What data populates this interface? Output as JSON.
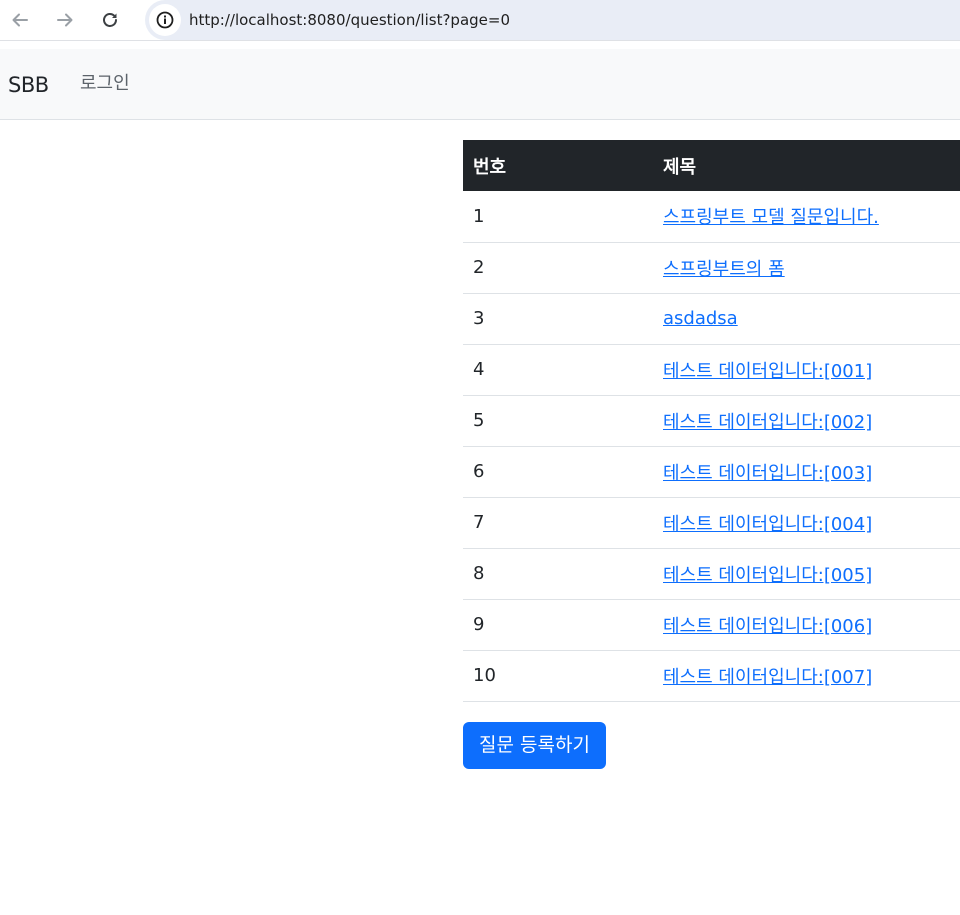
{
  "browser": {
    "back_icon": "arrow-left-icon",
    "forward_icon": "arrow-right-icon",
    "reload_icon": "reload-icon",
    "info_icon": "info-icon",
    "url": "http://localhost:8080/question/list?page=0"
  },
  "navbar": {
    "brand": "SBB",
    "login_label": "로그인"
  },
  "table": {
    "headers": {
      "num": "번호",
      "title": "제목"
    },
    "rows": [
      {
        "num": "1",
        "title": "스프링부트 모델 질문입니다."
      },
      {
        "num": "2",
        "title": "스프링부트의 폼"
      },
      {
        "num": "3",
        "title": "asdadsa"
      },
      {
        "num": "4",
        "title": "테스트 데이터입니다:[001]"
      },
      {
        "num": "5",
        "title": "테스트 데이터입니다:[002]"
      },
      {
        "num": "6",
        "title": "테스트 데이터입니다:[003]"
      },
      {
        "num": "7",
        "title": "테스트 데이터입니다:[004]"
      },
      {
        "num": "8",
        "title": "테스트 데이터입니다:[005]"
      },
      {
        "num": "9",
        "title": "테스트 데이터입니다:[006]"
      },
      {
        "num": "10",
        "title": "테스트 데이터입니다:[007]"
      }
    ]
  },
  "actions": {
    "create_label": "질문 등록하기"
  },
  "colors": {
    "primary": "#0d6efd",
    "table_header_bg": "#212529",
    "navbar_bg": "#f8f9fa"
  }
}
